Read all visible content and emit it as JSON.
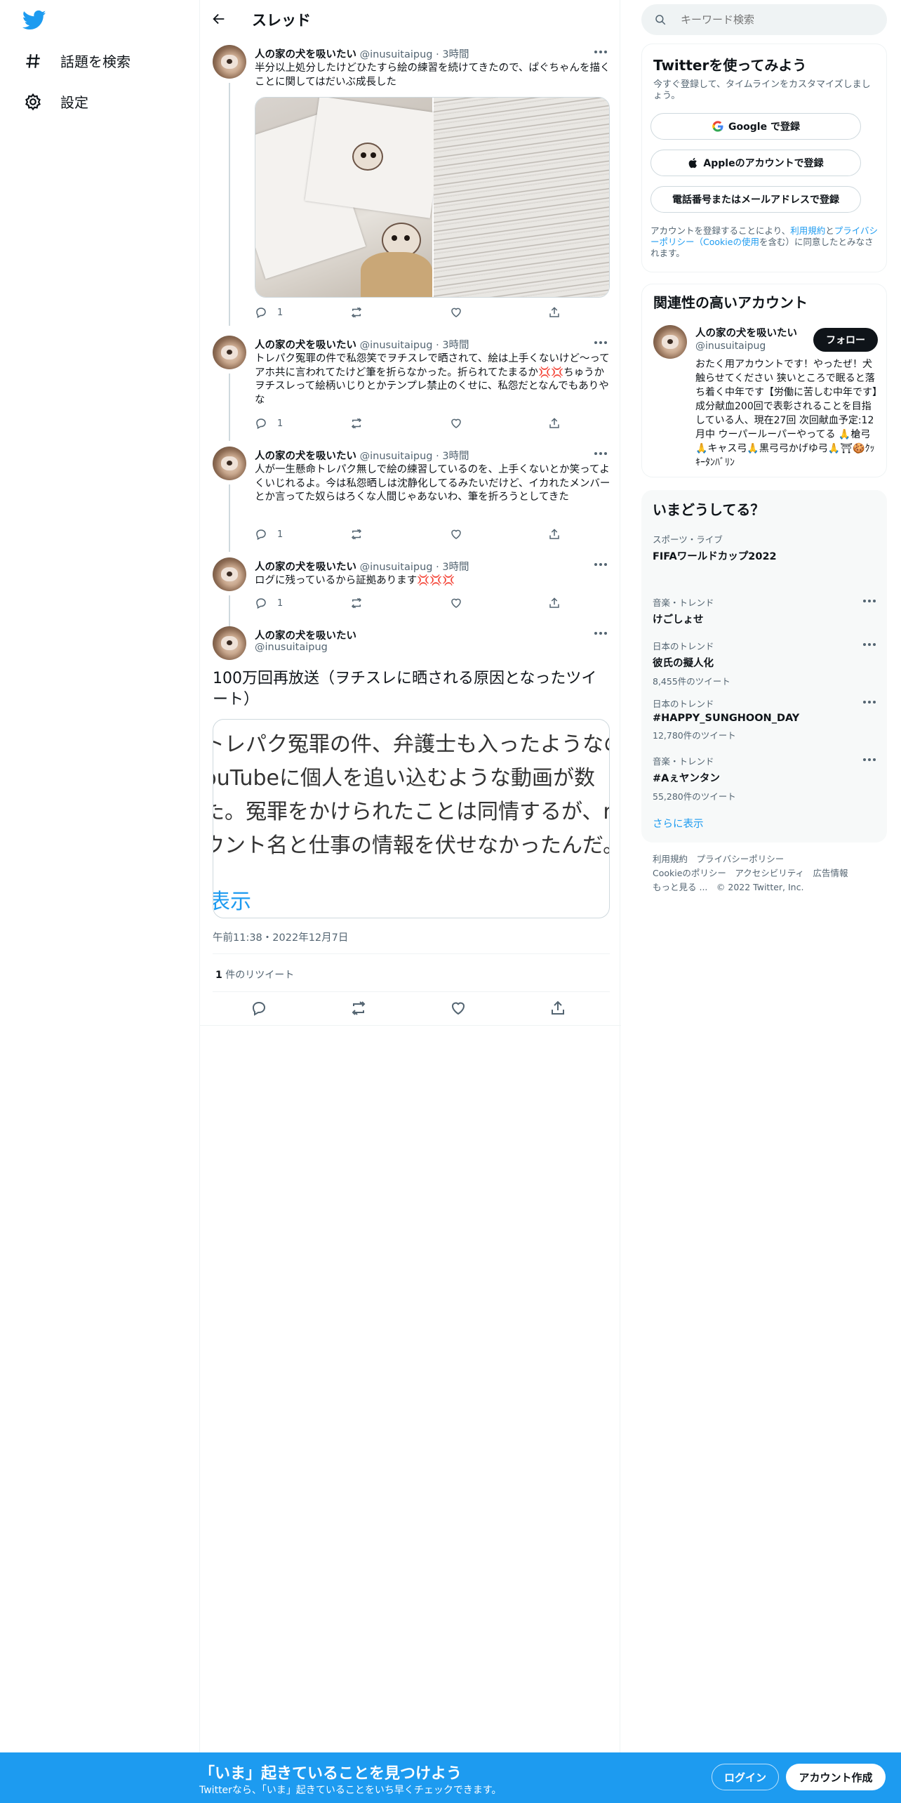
{
  "nav": {
    "items": [
      {
        "icon": "hashtag-icon",
        "label": "話題を検索"
      },
      {
        "icon": "gear-icon",
        "label": "設定"
      }
    ]
  },
  "header": {
    "title": "スレッド"
  },
  "tweets": [
    {
      "name": "人の家の犬を吸いたい",
      "handle": "@inusuitaipug",
      "time": "3時間",
      "text": "半分以上処分したけどひたすら絵の練習を続けてきたので、ぱぐちゃんを描くことに関してはだいぶ成長した",
      "reply_count": "1"
    },
    {
      "name": "人の家の犬を吸いたい",
      "handle": "@inusuitaipug",
      "time": "3時間",
      "text": "トレパク冤罪の件で私怨笑でヲチスレで晒されて、絵は上手くないけど〜ってアホ共に言われてたけど筆を折らなかった。折られてたまるか💢💢ちゅうかヲチスレって絵柄いじりとかテンプレ禁止のくせに、私怨だとなんでもありやな",
      "reply_count": "1"
    },
    {
      "name": "人の家の犬を吸いたい",
      "handle": "@inusuitaipug",
      "time": "3時間",
      "text": "人が一生懸命トレパク無しで絵の練習しているのを、上手くないとか笑ってよくいじれるよ。今は私怨晒しは沈静化してるみたいだけど、イカれたメンバーとか言ってた奴らはろくな人間じゃあないわ、筆を折ろうとしてきた",
      "reply_count": "1"
    },
    {
      "name": "人の家の犬を吸いたい",
      "handle": "@inusuitaipug",
      "time": "3時間",
      "text": "ログに残っているから証拠あります💢💢💢",
      "reply_count": "1"
    }
  ],
  "main_tweet": {
    "name": "人の家の犬を吸いたい",
    "handle": "@inusuitaipug",
    "text": "100万回再放送（ヲチスレに晒される原因となったツイート）",
    "quote_lines": [
      "トレパク冤罪の件、弁護士も入ったようなの",
      "YouTubeに個人を追い込むような動画が数",
      "た。冤罪をかけられたことは同情するが、n",
      "ウント名と仕事の情報を伏せなかったんだ。"
    ],
    "quote_more": "表示",
    "timestamp": "午前11:38・2022年12月7日",
    "retweet_count": "1",
    "retweet_label": "件のリツイート"
  },
  "search": {
    "placeholder": "キーワード検索"
  },
  "signup": {
    "title": "Twitterを使ってみよう",
    "subtitle": "今すぐ登録して、タイムラインをカスタマイズしましょう。",
    "google_button": "Google で登録",
    "apple_button": "Appleのアカウントで登録",
    "phone_button": "電話番号またはメールアドレスで登録",
    "terms_prefix": "アカウントを登録することにより、",
    "terms_link": "利用規約",
    "terms_and": "と",
    "privacy_link": "プライバシーポリシー",
    "cookie_link": "（Cookieの使用",
    "terms_suffix": "を含む）に同意したとみなされます。"
  },
  "related": {
    "title": "関連性の高いアカウント",
    "name": "人の家の犬を吸いたい",
    "handle": "@inusuitaipug",
    "follow_label": "フォロー",
    "bio": "おたく用アカウントです！やったぜ！犬触らせてください 狭いところで眠ると落ち着く中年です【労働に苦しむ中年です】成分献血200回で表彰されることを目指している人、現在27回 次回献血予定:12月中 ウーパールーパーやってる 🙏槍弓🙏キャス弓🙏黒弓弓かげゆ弓🙏⛩🍪ｸｯｷｰﾀﾝﾊﾞﾘﾝ"
  },
  "trends": {
    "title": "いまどうしてる？",
    "items": [
      {
        "category": "スポーツ・ライブ",
        "name": "FIFAワールドカップ2022",
        "count": ""
      },
      {
        "category": "音楽・トレンド",
        "name": "けごしょせ",
        "count": ""
      },
      {
        "category": "日本のトレンド",
        "name": "彼氏の擬人化",
        "count": "8,455件のツイート"
      },
      {
        "category": "日本のトレンド",
        "name": "#HAPPY_SUNGHOON_DAY",
        "count": "12,780件のツイート"
      },
      {
        "category": "音楽・トレンド",
        "name": "#Aぇヤンタン",
        "count": "55,280件のツイート"
      }
    ],
    "show_more": "さらに表示"
  },
  "footer": {
    "line1": "利用規約　プライバシーポリシー",
    "line2": "Cookieのポリシー　アクセシビリティ　広告情報",
    "line3": "もっと見る ...　© 2022 Twitter, Inc."
  },
  "bottom_bar": {
    "title": "「いま」起きていることを見つけよう",
    "subtitle": "Twitterなら、「いま」起きていることをいち早くチェックできます。",
    "login": "ログイン",
    "signup": "アカウント作成"
  },
  "colors": {
    "accent": "#1d9bf0",
    "text": "#0f1419",
    "muted": "#536471"
  }
}
